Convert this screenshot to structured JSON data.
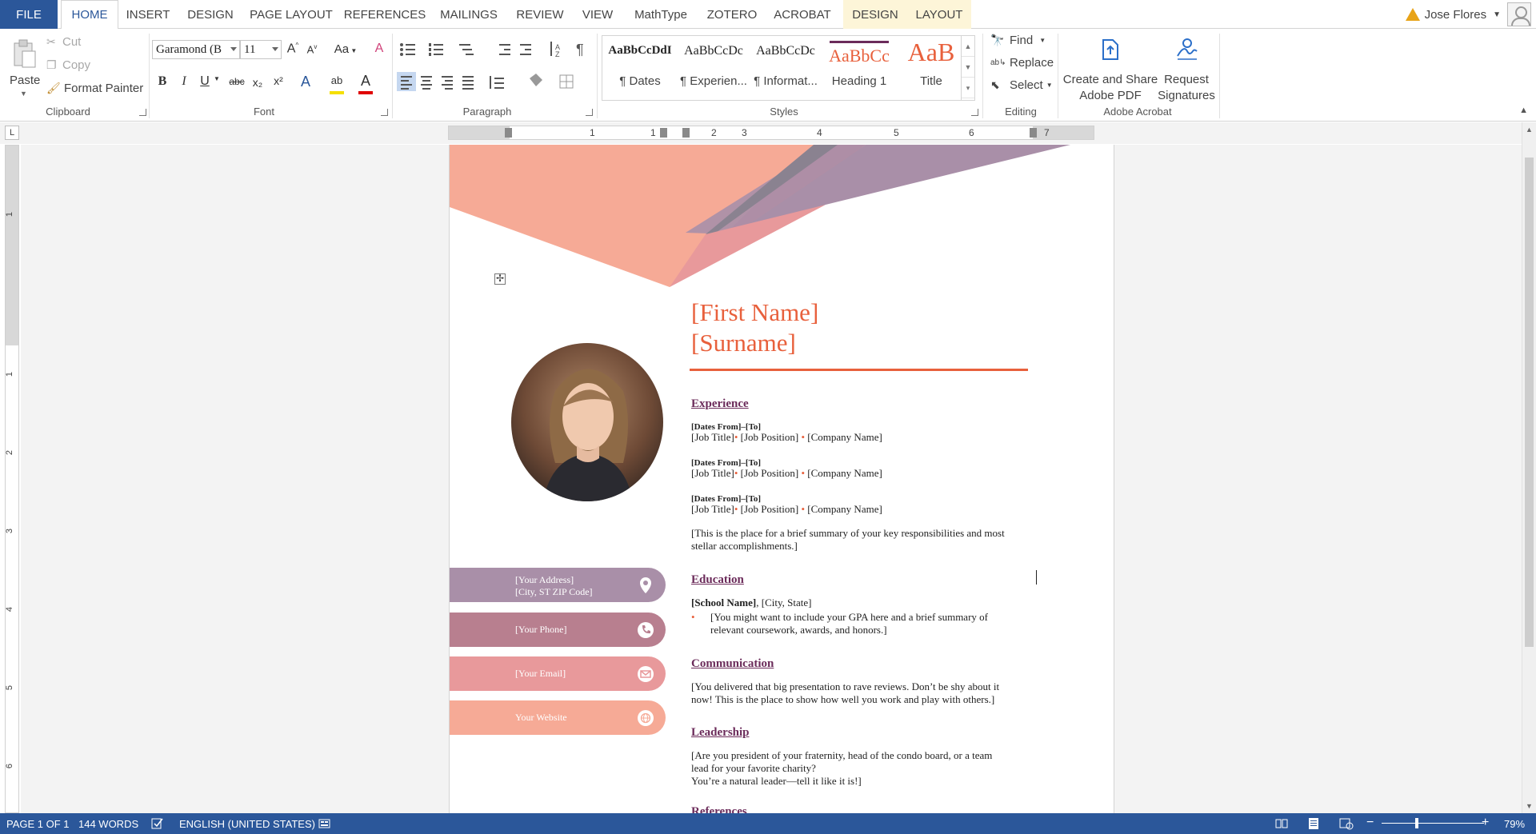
{
  "tabs": {
    "file": "FILE",
    "home": "HOME",
    "insert": "INSERT",
    "design": "DESIGN",
    "page_layout": "PAGE LAYOUT",
    "references": "REFERENCES",
    "mailings": "MAILINGS",
    "review": "REVIEW",
    "view": "VIEW",
    "mathtype": "MathType",
    "zotero": "ZOTERO",
    "acrobat": "ACROBAT",
    "table_design": "DESIGN",
    "table_layout": "LAYOUT"
  },
  "user": {
    "name": "Jose Flores"
  },
  "clipboard": {
    "paste": "Paste",
    "cut": "Cut",
    "copy": "Copy",
    "format_painter": "Format Painter",
    "label": "Clipboard"
  },
  "font": {
    "name": "Garamond (B",
    "size": "11",
    "change_case": "Aa",
    "label": "Font",
    "bold": "B",
    "italic": "I",
    "underline": "U",
    "strike": "abc",
    "subscript": "x₂",
    "superscript": "x²"
  },
  "paragraph": {
    "label": "Paragraph"
  },
  "styles": {
    "label": "Styles",
    "items": [
      {
        "sample": "AaBbCcDdI",
        "name": "¶ Dates"
      },
      {
        "sample": "AaBbCcDc",
        "name": "¶ Experien..."
      },
      {
        "sample": "AaBbCcDc",
        "name": "¶ Informat..."
      },
      {
        "sample": "AaBbCc",
        "name": "Heading 1"
      },
      {
        "sample": "AaB",
        "name": "Title"
      }
    ]
  },
  "editing": {
    "find": "Find",
    "replace": "Replace",
    "select": "Select",
    "label": "Editing"
  },
  "acrobat_group": {
    "create_share_1": "Create and Share",
    "create_share_2": "Adobe PDF",
    "request_1": "Request",
    "request_2": "Signatures",
    "label": "Adobe Acrobat"
  },
  "ruler": {
    "corner": "L",
    "h_numbers": [
      "1",
      "1",
      "2",
      "3",
      "4",
      "5",
      "6",
      "7"
    ],
    "v_numbers": [
      "1",
      "1",
      "2",
      "3",
      "4",
      "5",
      "6"
    ]
  },
  "resume": {
    "first_name": "[First Name]",
    "surname": "[Surname]",
    "experience_title": "Experience",
    "jobs": [
      {
        "dates": "[Dates From]–[To]",
        "title": "[Job Title]",
        "position": "[Job Position]",
        "company": "[Company Name]"
      },
      {
        "dates": "[Dates From]–[To]",
        "title": "[Job Title]",
        "position": "[Job Position]",
        "company": "[Company Name]"
      },
      {
        "dates": "[Dates From]–[To]",
        "title": "[Job Title]",
        "position": "[Job Position]",
        "company": "[Company Name]"
      }
    ],
    "summary_1": "[This is the place for a brief summary of your key responsibilities and most",
    "summary_2": "stellar accomplishments.]",
    "education_title": "Education",
    "school_name": "[School Name]",
    "school_location": ", [City, State]",
    "gpa_1": "[You might want to include your GPA here and a brief summary of",
    "gpa_2": "relevant coursework, awards, and honors.]",
    "communication_title": "Communication",
    "comm_1": "[You delivered that big presentation to rave reviews.  Don’t be shy about it",
    "comm_2": "now!  This is the place to show how well you work and play with others.]",
    "leadership_title": "Leadership",
    "lead_1": "[Are you president of your fraternity, head of the condo board, or a team",
    "lead_2": "lead for your favorite charity?",
    "lead_3": "You’re a natural leader—tell it like it is!]",
    "references_title": "References",
    "address_1": "[Your Address]",
    "address_2": "[City, ST ZIP Code]",
    "phone": "[Your Phone]",
    "email": "[Your Email]",
    "website": "Your Website"
  },
  "status": {
    "page": "PAGE 1 OF 1",
    "words": "144 WORDS",
    "language": "ENGLISH (UNITED STATES)",
    "zoom": "79%"
  },
  "colors": {
    "accent": "#2b579a",
    "name": "#e8603c",
    "section": "#6b2b5a",
    "address_bar": "#a98fa8",
    "phone_bar": "#b87f8f",
    "email_bar": "#e8999b",
    "website_bar": "#f6aa96"
  }
}
